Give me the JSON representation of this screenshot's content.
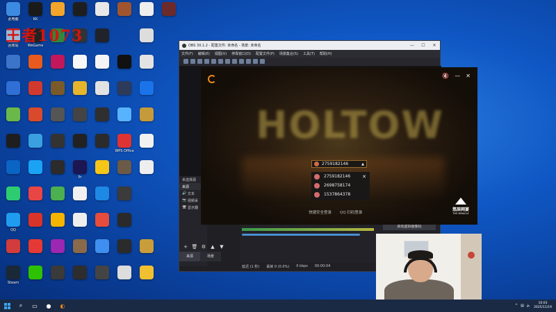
{
  "watermark": "王者1073",
  "desktop_icons": [
    {
      "label": "此电脑",
      "color": "#3d8be0",
      "col": 0,
      "row": 0
    },
    {
      "label": "KK",
      "color": "#1a1a1a",
      "col": 1,
      "row": 0
    },
    {
      "label": "",
      "color": "#f2a52b",
      "col": 2,
      "row": 0
    },
    {
      "label": "",
      "color": "#1e1e1e",
      "col": 3,
      "row": 0
    },
    {
      "label": "",
      "color": "#e8e8e8",
      "col": 4,
      "row": 0
    },
    {
      "label": "",
      "color": "#a0552f",
      "col": 5,
      "row": 0
    },
    {
      "label": "",
      "color": "#eeeeee",
      "col": 6,
      "row": 0
    },
    {
      "label": "",
      "color": "#6c2a2a",
      "col": 7,
      "row": 0
    },
    {
      "label": "回收站",
      "color": "#9cb7d8",
      "col": 0,
      "row": 1
    },
    {
      "label": "WeGame",
      "color": "#222222",
      "col": 1,
      "row": 1
    },
    {
      "label": "",
      "color": "#2b8a3e",
      "col": 2,
      "row": 1
    },
    {
      "label": "",
      "color": "#333333",
      "col": 3,
      "row": 1
    },
    {
      "label": "",
      "color": "#20232a",
      "col": 4,
      "row": 1
    },
    {
      "label": "",
      "color": "#dddddd",
      "col": 6,
      "row": 1
    },
    {
      "label": "",
      "color": "#3b74c9",
      "col": 0,
      "row": 2
    },
    {
      "label": "",
      "color": "#e85a1e",
      "col": 1,
      "row": 2
    },
    {
      "label": "",
      "color": "#c2185b",
      "col": 2,
      "row": 2
    },
    {
      "label": "",
      "color": "#f7f7f7",
      "col": 3,
      "row": 2
    },
    {
      "label": "",
      "color": "#f5f5f5",
      "col": 4,
      "row": 2
    },
    {
      "label": "",
      "color": "#111111",
      "col": 5,
      "row": 2
    },
    {
      "label": "",
      "color": "#e3e3e3",
      "col": 6,
      "row": 2
    },
    {
      "label": "",
      "color": "#2f6fd6",
      "col": 0,
      "row": 3
    },
    {
      "label": "",
      "color": "#d03a2e",
      "col": 1,
      "row": 3
    },
    {
      "label": "",
      "color": "#7a5a2a",
      "col": 2,
      "row": 3
    },
    {
      "label": "",
      "color": "#e4b52d",
      "col": 3,
      "row": 3
    },
    {
      "label": "",
      "color": "#e2e2e2",
      "col": 4,
      "row": 3
    },
    {
      "label": "",
      "color": "#2d3a5a",
      "col": 5,
      "row": 3
    },
    {
      "label": "",
      "color": "#1a73e8",
      "col": 6,
      "row": 3
    },
    {
      "label": "",
      "color": "#6bb84a",
      "col": 0,
      "row": 4
    },
    {
      "label": "",
      "color": "#d84a2b",
      "col": 1,
      "row": 4
    },
    {
      "label": "",
      "color": "#555555",
      "col": 2,
      "row": 4
    },
    {
      "label": "",
      "color": "#444444",
      "col": 3,
      "row": 4
    },
    {
      "label": "",
      "color": "#2f2f2f",
      "col": 4,
      "row": 4
    },
    {
      "label": "",
      "color": "#58b3ff",
      "col": 5,
      "row": 4
    },
    {
      "label": "",
      "color": "#c49a3a",
      "col": 6,
      "row": 4
    },
    {
      "label": "",
      "color": "#1e1e1e",
      "col": 0,
      "row": 5
    },
    {
      "label": "",
      "color": "#3aa0e0",
      "col": 1,
      "row": 5
    },
    {
      "label": "",
      "color": "#333333",
      "col": 2,
      "row": 5
    },
    {
      "label": "",
      "color": "#222222",
      "col": 3,
      "row": 5
    },
    {
      "label": "",
      "color": "#2b2b2b",
      "col": 4,
      "row": 5
    },
    {
      "label": "WPS Office",
      "color": "#d33",
      "col": 5,
      "row": 5
    },
    {
      "label": "",
      "color": "#f1f1f1",
      "col": 6,
      "row": 5
    },
    {
      "label": "",
      "color": "#0a64c4",
      "col": 0,
      "row": 6
    },
    {
      "label": "",
      "color": "#1aa3f5",
      "col": 1,
      "row": 6
    },
    {
      "label": "",
      "color": "#2b2b2b",
      "col": 2,
      "row": 6
    },
    {
      "label": "Pr",
      "color": "#1c1652",
      "col": 3,
      "row": 6
    },
    {
      "label": "",
      "color": "#f5c518",
      "col": 4,
      "row": 6
    },
    {
      "label": "",
      "color": "#6b5a47",
      "col": 5,
      "row": 6
    },
    {
      "label": "",
      "color": "#eeeeee",
      "col": 6,
      "row": 6
    },
    {
      "label": "",
      "color": "#2ecc71",
      "col": 0,
      "row": 7
    },
    {
      "label": "",
      "color": "#e84545",
      "col": 1,
      "row": 7
    },
    {
      "label": "",
      "color": "#4caf50",
      "col": 2,
      "row": 7
    },
    {
      "label": "",
      "color": "#f0f0f0",
      "col": 3,
      "row": 7
    },
    {
      "label": "",
      "color": "#1e88e5",
      "col": 4,
      "row": 7
    },
    {
      "label": "",
      "color": "#3b3b3b",
      "col": 5,
      "row": 7
    },
    {
      "label": "QQ",
      "color": "#1f9cf0",
      "col": 0,
      "row": 8
    },
    {
      "label": "",
      "color": "#d8342a",
      "col": 1,
      "row": 8
    },
    {
      "label": "",
      "color": "#f4b400",
      "col": 2,
      "row": 8
    },
    {
      "label": "",
      "color": "#eeeeee",
      "col": 3,
      "row": 8
    },
    {
      "label": "",
      "color": "#e74c3c",
      "col": 4,
      "row": 8
    },
    {
      "label": "",
      "color": "#2a2a2a",
      "col": 5,
      "row": 8
    },
    {
      "label": "",
      "color": "#d23c3c",
      "col": 0,
      "row": 9
    },
    {
      "label": "",
      "color": "#e53935",
      "col": 1,
      "row": 9
    },
    {
      "label": "",
      "color": "#9c27b0",
      "col": 2,
      "row": 9
    },
    {
      "label": "",
      "color": "#8a6a4a",
      "col": 3,
      "row": 9
    },
    {
      "label": "",
      "color": "#3f8ff0",
      "col": 4,
      "row": 9
    },
    {
      "label": "",
      "color": "#2b2b2b",
      "col": 5,
      "row": 9
    },
    {
      "label": "",
      "color": "#c89d3a",
      "col": 6,
      "row": 9
    },
    {
      "label": "Steam",
      "color": "#1b2838",
      "col": 0,
      "row": 10
    },
    {
      "label": "",
      "color": "#2dc100",
      "col": 1,
      "row": 10
    },
    {
      "label": "",
      "color": "#3a3a3a",
      "col": 2,
      "row": 10
    },
    {
      "label": "",
      "color": "#2d2d2d",
      "col": 3,
      "row": 10
    },
    {
      "label": "",
      "color": "#444444",
      "col": 4,
      "row": 10
    },
    {
      "label": "",
      "color": "#dddddd",
      "col": 5,
      "row": 10
    },
    {
      "label": "",
      "color": "#f0c030",
      "col": 6,
      "row": 10
    }
  ],
  "obs": {
    "title": "OBS 30.1.2 - 配置文件: 未命名 - 场景: 未命名",
    "menu": [
      "文件(F)",
      "编辑(E)",
      "视图(V)",
      "停靠窗口(D)",
      "配置文件(P)",
      "场景集合(S)",
      "工具(T)",
      "帮助(H)"
    ],
    "dock_header": "未选择源",
    "sources_tab": "来源",
    "sources": [
      "文本",
      "视频采",
      "显示器"
    ],
    "vcam_button": "启动虚拟摄像机",
    "tabs": [
      "来源",
      "场景"
    ],
    "status": {
      "delay": "延迟 (1 秒)",
      "recording": "丢帧 0 (0.0%)",
      "kbps": "0 kbps",
      "time": "00:00:04"
    }
  },
  "login": {
    "banner": "HOLTOW",
    "selected_account": "2759182146",
    "accounts": [
      "2759182146",
      "2698758174",
      "1537864378"
    ],
    "fast_login": "快捷安全登录",
    "qq_login": "QQ 扫码登录",
    "brand": "悠辰网宴",
    "brand_sub": "THE MIRACLE"
  },
  "taskbar": {
    "time": "10:03",
    "date": "2025/11/19"
  }
}
